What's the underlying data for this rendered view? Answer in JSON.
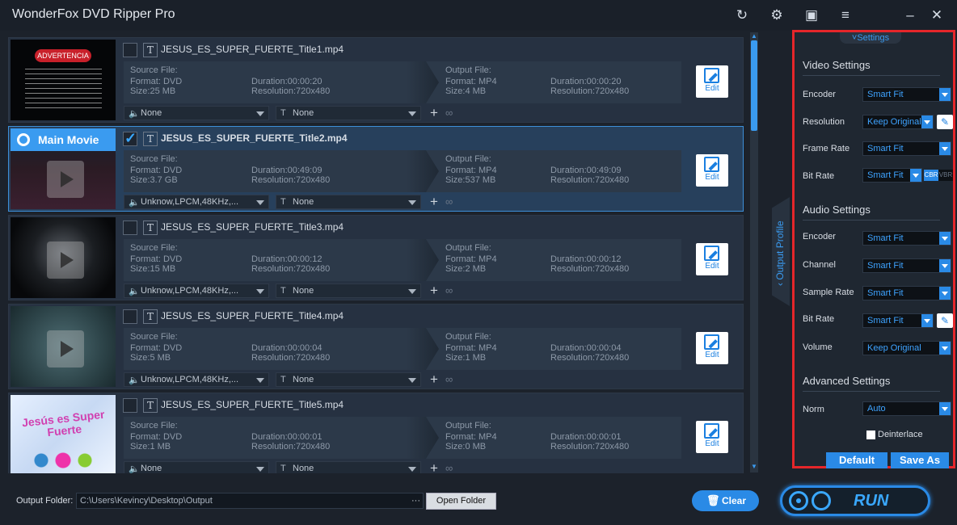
{
  "app": {
    "title": "WonderFox DVD Ripper Pro"
  },
  "titlebar": {
    "icons": [
      "refresh-icon",
      "settings-gear-icon",
      "feedback-icon",
      "menu-icon",
      "minimize-icon",
      "close-icon"
    ]
  },
  "files": [
    {
      "name": "JESUS_ES_SUPER_FUERTE_Title1.mp4",
      "checked": false,
      "thumb_label": "ADVERTENCIA",
      "source": {
        "label": "Source File:",
        "format": "Format: DVD",
        "size": "Size:25 MB",
        "duration": "Duration:00:00:20",
        "resolution": "Resolution:720x480"
      },
      "output": {
        "label": "Output File:",
        "format": "Format: MP4",
        "size": "Size:4 MB",
        "duration": "Duration:00:00:20",
        "resolution": "Resolution:720x480"
      },
      "audio": "None",
      "subtitle": "None",
      "edit": "Edit"
    },
    {
      "name": "JESUS_ES_SUPER_FUERTE_Title2.mp4",
      "checked": true,
      "thumb_label": "Main Movie",
      "source": {
        "label": "Source File:",
        "format": "Format: DVD",
        "size": "Size:3.7 GB",
        "duration": "Duration:00:49:09",
        "resolution": "Resolution:720x480"
      },
      "output": {
        "label": "Output File:",
        "format": "Format: MP4",
        "size": "Size:537 MB",
        "duration": "Duration:00:49:09",
        "resolution": "Resolution:720x480"
      },
      "audio": "Unknow,LPCM,48KHz,...",
      "subtitle": "None",
      "edit": "Edit"
    },
    {
      "name": "JESUS_ES_SUPER_FUERTE_Title3.mp4",
      "checked": false,
      "thumb_label": "",
      "source": {
        "label": "Source File:",
        "format": "Format: DVD",
        "size": "Size:15 MB",
        "duration": "Duration:00:00:12",
        "resolution": "Resolution:720x480"
      },
      "output": {
        "label": "Output File:",
        "format": "Format: MP4",
        "size": "Size:2 MB",
        "duration": "Duration:00:00:12",
        "resolution": "Resolution:720x480"
      },
      "audio": "Unknow,LPCM,48KHz,...",
      "subtitle": "None",
      "edit": "Edit"
    },
    {
      "name": "JESUS_ES_SUPER_FUERTE_Title4.mp4",
      "checked": false,
      "thumb_label": "",
      "source": {
        "label": "Source File:",
        "format": "Format: DVD",
        "size": "Size:5 MB",
        "duration": "Duration:00:00:04",
        "resolution": "Resolution:720x480"
      },
      "output": {
        "label": "Output File:",
        "format": "Format: MP4",
        "size": "Size:1 MB",
        "duration": "Duration:00:00:04",
        "resolution": "Resolution:720x480"
      },
      "audio": "Unknow,LPCM,48KHz,...",
      "subtitle": "None",
      "edit": "Edit"
    },
    {
      "name": "JESUS_ES_SUPER_FUERTE_Title5.mp4",
      "checked": false,
      "thumb_label": "Jesús es Super Fuerte",
      "source": {
        "label": "Source File:",
        "format": "Format: DVD",
        "size": "Size:1 MB",
        "duration": "Duration:00:00:01",
        "resolution": "Resolution:720x480"
      },
      "output": {
        "label": "Output File:",
        "format": "Format: MP4",
        "size": "Size:0 MB",
        "duration": "Duration:00:00:01",
        "resolution": "Resolution:720x480"
      },
      "audio": "None",
      "subtitle": "None",
      "edit": "Edit"
    }
  ],
  "output_profile_tab": "Output Profile",
  "settings": {
    "tab": "Settings",
    "video_title": "Video Settings",
    "audio_title": "Audio Settings",
    "advanced_title": "Advanced Settings",
    "video": [
      {
        "label": "Encoder",
        "value": "Smart Fit"
      },
      {
        "label": "Resolution",
        "value": "Keep Original"
      },
      {
        "label": "Frame Rate",
        "value": "Smart Fit"
      },
      {
        "label": "Bit Rate",
        "value": "Smart Fit"
      }
    ],
    "cbr": "CBR",
    "vbr": "VBR",
    "audio": [
      {
        "label": "Encoder",
        "value": "Smart Fit"
      },
      {
        "label": "Channel",
        "value": "Smart Fit"
      },
      {
        "label": "Sample Rate",
        "value": "Smart Fit"
      },
      {
        "label": "Bit Rate",
        "value": "Smart Fit"
      },
      {
        "label": "Volume",
        "value": "Keep Original"
      }
    ],
    "norm_label": "Norm",
    "norm_value": "Auto",
    "deinterlace": "Deinterlace",
    "default_btn": "Default",
    "saveas_btn": "Save As"
  },
  "bottom": {
    "output_label": "Output Folder:",
    "output_path": "C:\\Users\\Kevincy\\Desktop\\Output",
    "browse": "···",
    "open_folder": "Open Folder",
    "clear": "Clear",
    "run": "RUN"
  },
  "colors": {
    "accent": "#2a8ae6",
    "highlight_border": "#e5262a",
    "selected_row": "#27405c"
  }
}
